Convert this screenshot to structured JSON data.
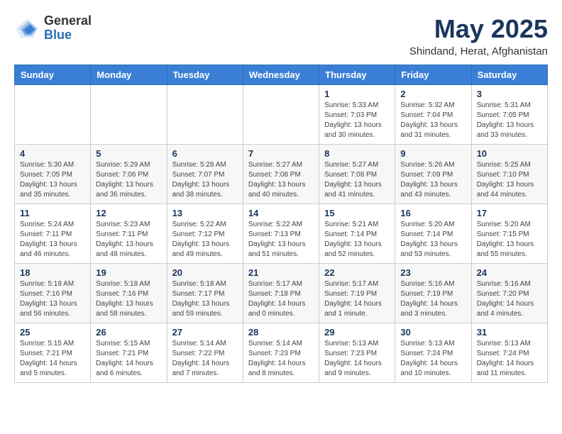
{
  "logo": {
    "general": "General",
    "blue": "Blue"
  },
  "title": "May 2025",
  "subtitle": "Shindand, Herat, Afghanistan",
  "headers": [
    "Sunday",
    "Monday",
    "Tuesday",
    "Wednesday",
    "Thursday",
    "Friday",
    "Saturday"
  ],
  "weeks": [
    [
      {
        "day": "",
        "info": ""
      },
      {
        "day": "",
        "info": ""
      },
      {
        "day": "",
        "info": ""
      },
      {
        "day": "",
        "info": ""
      },
      {
        "day": "1",
        "info": "Sunrise: 5:33 AM\nSunset: 7:03 PM\nDaylight: 13 hours\nand 30 minutes."
      },
      {
        "day": "2",
        "info": "Sunrise: 5:32 AM\nSunset: 7:04 PM\nDaylight: 13 hours\nand 31 minutes."
      },
      {
        "day": "3",
        "info": "Sunrise: 5:31 AM\nSunset: 7:05 PM\nDaylight: 13 hours\nand 33 minutes."
      }
    ],
    [
      {
        "day": "4",
        "info": "Sunrise: 5:30 AM\nSunset: 7:05 PM\nDaylight: 13 hours\nand 35 minutes."
      },
      {
        "day": "5",
        "info": "Sunrise: 5:29 AM\nSunset: 7:06 PM\nDaylight: 13 hours\nand 36 minutes."
      },
      {
        "day": "6",
        "info": "Sunrise: 5:28 AM\nSunset: 7:07 PM\nDaylight: 13 hours\nand 38 minutes."
      },
      {
        "day": "7",
        "info": "Sunrise: 5:27 AM\nSunset: 7:08 PM\nDaylight: 13 hours\nand 40 minutes."
      },
      {
        "day": "8",
        "info": "Sunrise: 5:27 AM\nSunset: 7:08 PM\nDaylight: 13 hours\nand 41 minutes."
      },
      {
        "day": "9",
        "info": "Sunrise: 5:26 AM\nSunset: 7:09 PM\nDaylight: 13 hours\nand 43 minutes."
      },
      {
        "day": "10",
        "info": "Sunrise: 5:25 AM\nSunset: 7:10 PM\nDaylight: 13 hours\nand 44 minutes."
      }
    ],
    [
      {
        "day": "11",
        "info": "Sunrise: 5:24 AM\nSunset: 7:11 PM\nDaylight: 13 hours\nand 46 minutes."
      },
      {
        "day": "12",
        "info": "Sunrise: 5:23 AM\nSunset: 7:11 PM\nDaylight: 13 hours\nand 48 minutes."
      },
      {
        "day": "13",
        "info": "Sunrise: 5:22 AM\nSunset: 7:12 PM\nDaylight: 13 hours\nand 49 minutes."
      },
      {
        "day": "14",
        "info": "Sunrise: 5:22 AM\nSunset: 7:13 PM\nDaylight: 13 hours\nand 51 minutes."
      },
      {
        "day": "15",
        "info": "Sunrise: 5:21 AM\nSunset: 7:14 PM\nDaylight: 13 hours\nand 52 minutes."
      },
      {
        "day": "16",
        "info": "Sunrise: 5:20 AM\nSunset: 7:14 PM\nDaylight: 13 hours\nand 53 minutes."
      },
      {
        "day": "17",
        "info": "Sunrise: 5:20 AM\nSunset: 7:15 PM\nDaylight: 13 hours\nand 55 minutes."
      }
    ],
    [
      {
        "day": "18",
        "info": "Sunrise: 5:19 AM\nSunset: 7:16 PM\nDaylight: 13 hours\nand 56 minutes."
      },
      {
        "day": "19",
        "info": "Sunrise: 5:18 AM\nSunset: 7:16 PM\nDaylight: 13 hours\nand 58 minutes."
      },
      {
        "day": "20",
        "info": "Sunrise: 5:18 AM\nSunset: 7:17 PM\nDaylight: 13 hours\nand 59 minutes."
      },
      {
        "day": "21",
        "info": "Sunrise: 5:17 AM\nSunset: 7:18 PM\nDaylight: 14 hours\nand 0 minutes."
      },
      {
        "day": "22",
        "info": "Sunrise: 5:17 AM\nSunset: 7:19 PM\nDaylight: 14 hours\nand 1 minute."
      },
      {
        "day": "23",
        "info": "Sunrise: 5:16 AM\nSunset: 7:19 PM\nDaylight: 14 hours\nand 3 minutes."
      },
      {
        "day": "24",
        "info": "Sunrise: 5:16 AM\nSunset: 7:20 PM\nDaylight: 14 hours\nand 4 minutes."
      }
    ],
    [
      {
        "day": "25",
        "info": "Sunrise: 5:15 AM\nSunset: 7:21 PM\nDaylight: 14 hours\nand 5 minutes."
      },
      {
        "day": "26",
        "info": "Sunrise: 5:15 AM\nSunset: 7:21 PM\nDaylight: 14 hours\nand 6 minutes."
      },
      {
        "day": "27",
        "info": "Sunrise: 5:14 AM\nSunset: 7:22 PM\nDaylight: 14 hours\nand 7 minutes."
      },
      {
        "day": "28",
        "info": "Sunrise: 5:14 AM\nSunset: 7:23 PM\nDaylight: 14 hours\nand 8 minutes."
      },
      {
        "day": "29",
        "info": "Sunrise: 5:13 AM\nSunset: 7:23 PM\nDaylight: 14 hours\nand 9 minutes."
      },
      {
        "day": "30",
        "info": "Sunrise: 5:13 AM\nSunset: 7:24 PM\nDaylight: 14 hours\nand 10 minutes."
      },
      {
        "day": "31",
        "info": "Sunrise: 5:13 AM\nSunset: 7:24 PM\nDaylight: 14 hours\nand 11 minutes."
      }
    ]
  ]
}
